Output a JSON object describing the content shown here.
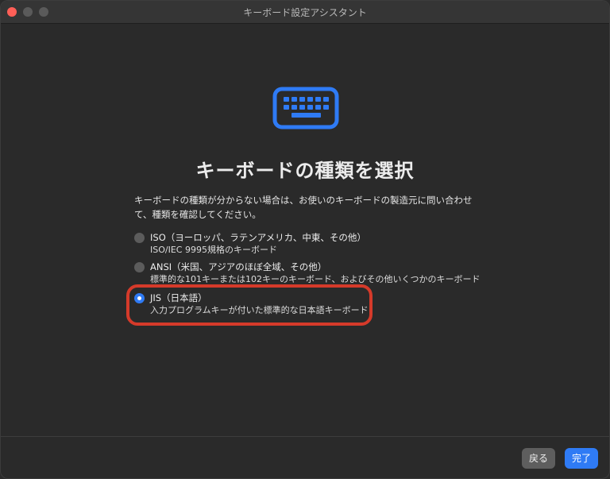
{
  "window": {
    "title": "キーボード設定アシスタント"
  },
  "icon": "keyboard-icon",
  "heading": "キーボードの種類を選択",
  "description": "キーボードの種類が分からない場合は、お使いのキーボードの製造元に問い合わせて、種類を確認してください。",
  "options": [
    {
      "title": "ISO（ヨーロッパ、ラテンアメリカ、中東、その他）",
      "subtitle": "ISO/IEC 9995規格のキーボード",
      "selected": false
    },
    {
      "title": "ANSI（米国、アジアのほぼ全域、その他）",
      "subtitle": "標準的な101キーまたは102キーのキーボード、およびその他いくつかのキーボード",
      "selected": false
    },
    {
      "title": "JIS（日本語）",
      "subtitle": "入力プログラムキーが付いた標準的な日本語キーボード",
      "selected": true
    }
  ],
  "buttons": {
    "back": "戻る",
    "done": "完了"
  },
  "colors": {
    "accent": "#2f7bf5",
    "highlight_border": "#d53a2a",
    "background": "#2a2a2a"
  }
}
